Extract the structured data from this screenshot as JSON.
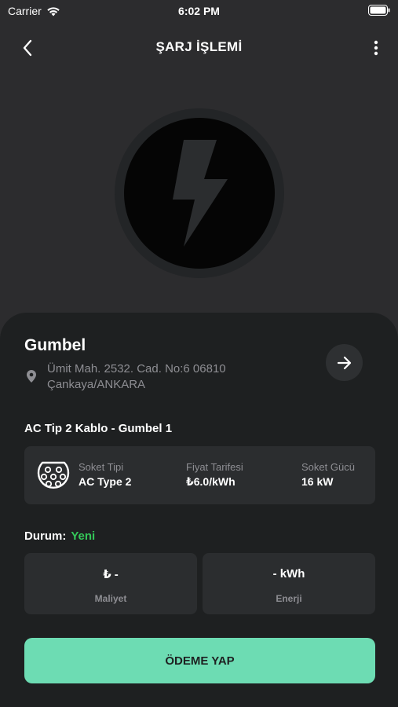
{
  "status_bar": {
    "carrier": "Carrier",
    "time": "6:02 PM"
  },
  "header": {
    "title": "ŞARJ İŞLEMİ",
    "back_icon": "chevron-left-icon",
    "more_icon": "more-vertical-icon"
  },
  "hero": {
    "icon": "lightning-bolt-icon"
  },
  "station": {
    "name": "Gumbel",
    "address_line1": "Ümit Mah. 2532. Cad. No:6 06810",
    "address_line2": "Çankaya/ANKARA"
  },
  "connector": {
    "title": "AC Tip 2 Kablo - Gumbel 1",
    "socket_type_label": "Soket Tipi",
    "socket_type_value": "AC Type 2",
    "price_label": "Fiyat Tarifesi",
    "price_value": "₺6.0/kWh",
    "power_label": "Soket Gücü",
    "power_value": "16 kW"
  },
  "status": {
    "label": "Durum:",
    "value": "Yeni"
  },
  "stats": {
    "cost_value": "₺ -",
    "cost_caption": "Maliyet",
    "energy_value": "- kWh",
    "energy_caption": "Enerji"
  },
  "actions": {
    "pay_label": "ÖDEME YAP"
  },
  "colors": {
    "background": "#2c2c2e",
    "sheet": "#1e2021",
    "card": "#2b2d2f",
    "accent": "#6ddcb3",
    "status_green": "#34c759",
    "muted_text": "#8e8e93"
  }
}
